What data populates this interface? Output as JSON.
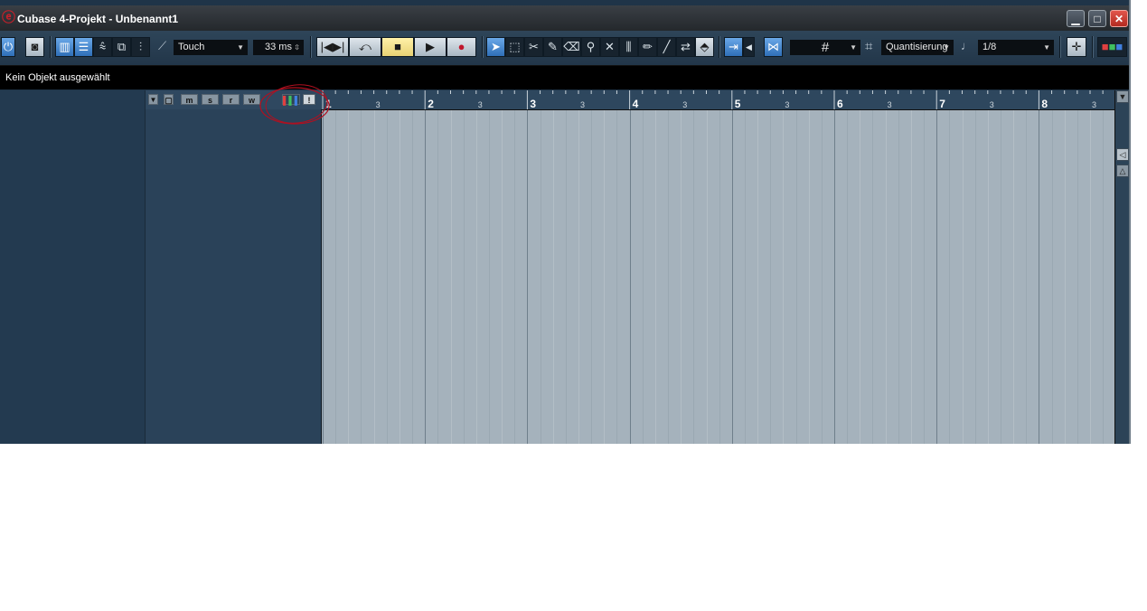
{
  "window": {
    "title": "Cubase 4-Projekt - Unbenannt1",
    "minimize_label": "▁",
    "maximize_label": "□",
    "close_label": "✕"
  },
  "toolbar": {
    "automation_mode": "Touch",
    "latency_value": "33 ms",
    "snap_type_value": "",
    "quantize_label": "Quantisierung",
    "quantize_value": "1/8",
    "transport": [
      "|◀▶|",
      "⤺",
      "■",
      "▶",
      "●"
    ]
  },
  "info_line": {
    "text": "Kein Objekt ausgewählt"
  },
  "track_list_header": {
    "buttons": [
      "m",
      "s",
      "r",
      "w"
    ]
  },
  "ruler": {
    "bars": [
      "1",
      "2",
      "3",
      "4",
      "5",
      "6",
      "7",
      "8"
    ],
    "sub_label": "3"
  },
  "colors": {
    "background": "#1f3448",
    "event_area": "#a5b2bc",
    "accent": "#2f6fb8",
    "record": "#c0162c",
    "annotation": "#b01020"
  }
}
